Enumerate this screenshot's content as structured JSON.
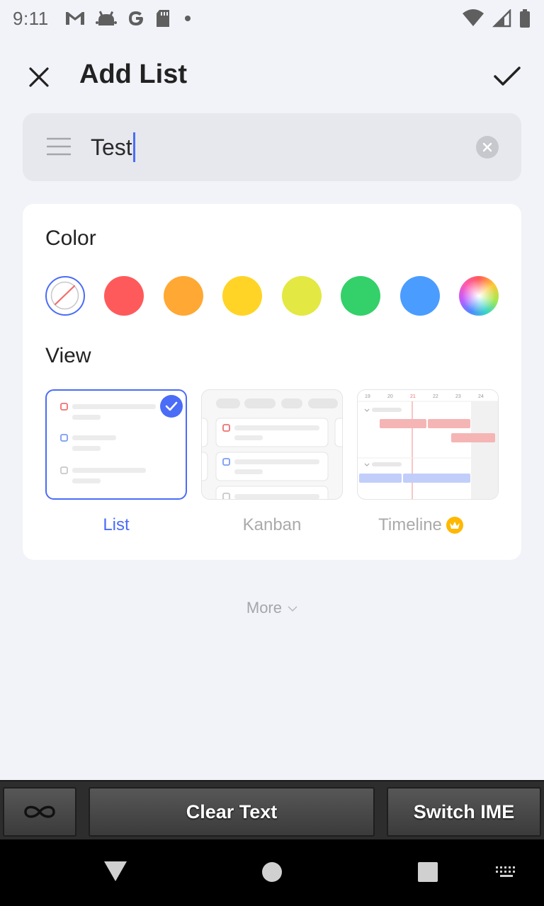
{
  "status_bar": {
    "time": "9:11",
    "notification_icons": [
      "gmail-icon",
      "android-icon",
      "google-icon",
      "sd-card-icon",
      "dot-icon"
    ],
    "system_icons": [
      "wifi-icon",
      "signal-icon",
      "battery-icon"
    ]
  },
  "header": {
    "title": "Add List",
    "close_icon": "close-icon",
    "confirm_icon": "check-icon"
  },
  "name_field": {
    "value": "Test",
    "menu_icon": "menu-icon",
    "clear_icon": "clear-icon"
  },
  "color_section": {
    "label": "Color",
    "swatches": [
      {
        "name": "none",
        "color": "#ffffff",
        "selected": true
      },
      {
        "name": "red",
        "color": "#fe5a5b"
      },
      {
        "name": "orange",
        "color": "#ffa833"
      },
      {
        "name": "yellow",
        "color": "#ffd426"
      },
      {
        "name": "lime",
        "color": "#e3e843"
      },
      {
        "name": "green",
        "color": "#34d06a"
      },
      {
        "name": "blue",
        "color": "#4a9cff"
      },
      {
        "name": "custom",
        "color": "gradient"
      }
    ]
  },
  "view_section": {
    "label": "View",
    "options": [
      {
        "label": "List",
        "selected": true
      },
      {
        "label": "Kanban",
        "selected": false
      },
      {
        "label": "Timeline",
        "selected": false,
        "premium": true
      }
    ],
    "timeline_dates": [
      "19",
      "20",
      "21",
      "22",
      "23",
      "24"
    ]
  },
  "more": {
    "label": "More"
  },
  "ime_bar": {
    "infinity_icon": "infinity-icon",
    "clear_text": "Clear Text",
    "switch_ime": "Switch IME"
  },
  "nav_bar": {
    "back_icon": "back-triangle-icon",
    "home_icon": "home-circle-icon",
    "recents_icon": "recents-square-icon",
    "keyboard_icon": "keyboard-icon"
  },
  "colors": {
    "accent": "#4a6cf7",
    "background": "#f2f3f8",
    "premium": "#ffb800"
  }
}
